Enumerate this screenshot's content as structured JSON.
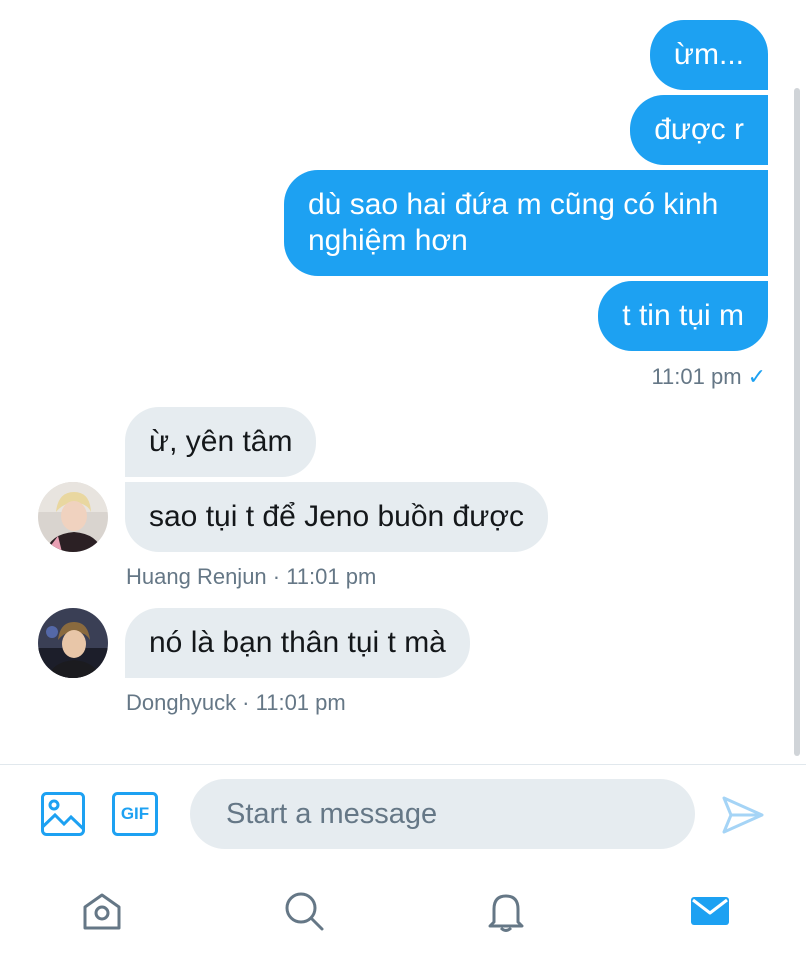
{
  "conversation": {
    "outgoing": [
      {
        "text": "ừm..."
      },
      {
        "text": "được r"
      },
      {
        "text": "dù sao hai đứa m cũng có kinh nghiệm hơn"
      },
      {
        "text": "t tin tụi m"
      }
    ],
    "outgoing_meta": {
      "time": "11:01 pm",
      "status_icon": "check-icon"
    },
    "groups": [
      {
        "sender": "Huang Renjun",
        "time": "11:01 pm",
        "messages": [
          {
            "text": "ừ, yên tâm"
          },
          {
            "text": "sao tụi t để Jeno buồn được"
          }
        ],
        "meta": "Huang Renjun · 11:01 pm"
      },
      {
        "sender": "Donghyuck",
        "time": "11:01 pm",
        "messages": [
          {
            "text": "nó là bạn thân tụi t mà"
          }
        ],
        "meta": "Donghyuck · 11:01 pm"
      }
    ]
  },
  "composer": {
    "placeholder": "Start a message",
    "value": "",
    "media_icon": "image-icon",
    "gif_label": "GIF",
    "send_icon": "send-icon"
  },
  "tabbar": {
    "items": [
      {
        "name": "home",
        "icon": "home-icon"
      },
      {
        "name": "search",
        "icon": "search-icon"
      },
      {
        "name": "notifications",
        "icon": "bell-icon"
      },
      {
        "name": "messages",
        "icon": "mail-icon",
        "active": true
      }
    ]
  },
  "colors": {
    "accent": "#1da1f2",
    "incoming_bubble": "#e6ecf0",
    "muted_text": "#657786",
    "icon_gray": "#657786"
  }
}
